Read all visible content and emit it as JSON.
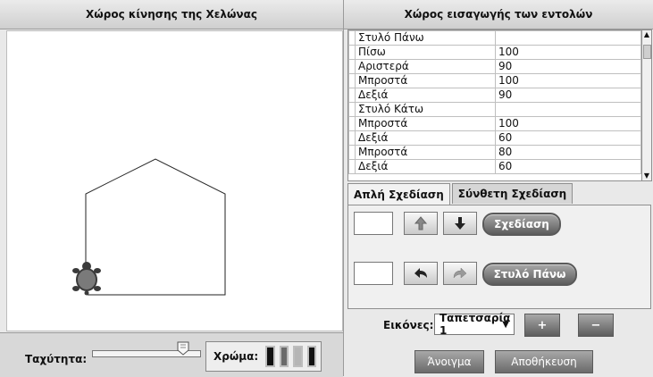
{
  "left": {
    "title": "Χώρος κίνησης της Χελώνας",
    "speed_label": "Ταχύτητα:",
    "speed_value": 0.85,
    "color_label": "Χρώμα:",
    "swatches": [
      "#111111",
      "#6a6a6a",
      "#b5b5b5",
      "#111111"
    ]
  },
  "right": {
    "title": "Χώρος εισαγωγής των εντολών",
    "commands": [
      {
        "cmd": "Στυλό Πάνω",
        "val": ""
      },
      {
        "cmd": "Πίσω",
        "val": "100"
      },
      {
        "cmd": "Αριστερά",
        "val": "90"
      },
      {
        "cmd": "Μπροστά",
        "val": "100"
      },
      {
        "cmd": "Δεξιά",
        "val": "90"
      },
      {
        "cmd": "Στυλό Κάτω",
        "val": ""
      },
      {
        "cmd": "Μπροστά",
        "val": "100"
      },
      {
        "cmd": "Δεξιά",
        "val": "60"
      },
      {
        "cmd": "Μπροστά",
        "val": "80"
      },
      {
        "cmd": "Δεξιά",
        "val": "60"
      }
    ],
    "tabs": [
      "Απλή Σχεδίαση",
      "Σύνθετη Σχεδίαση"
    ],
    "draw_button": "Σχεδίαση",
    "pen_up_button": "Στυλό Πάνω",
    "images_label": "Εικόνες:",
    "images_select": "Ταπετσαρία 1",
    "plus_label": "+",
    "minus_label": "−",
    "open_button": "Άνοιγμα",
    "save_button": "Αποθήκευση"
  }
}
